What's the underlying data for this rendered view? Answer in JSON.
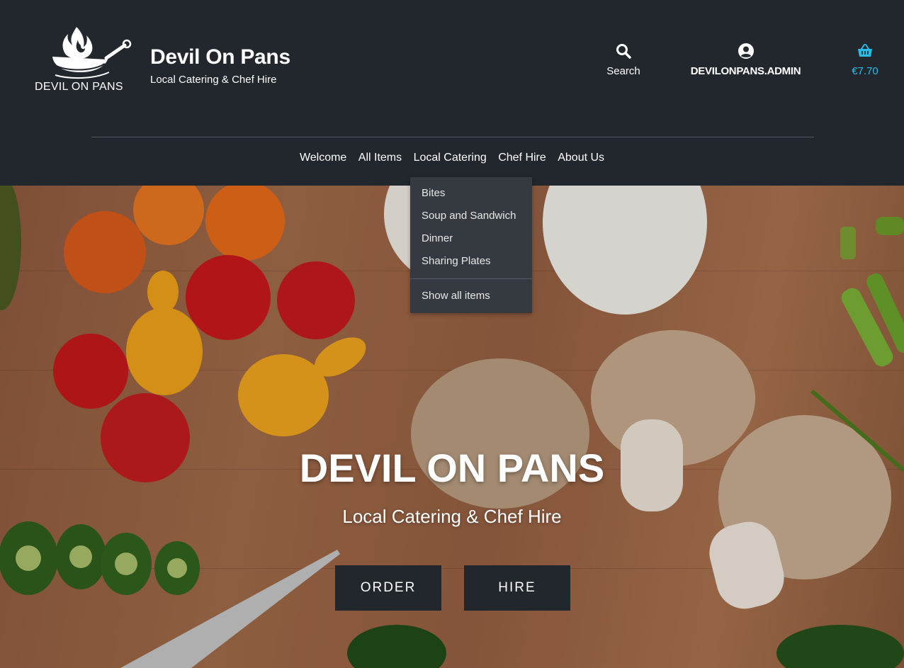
{
  "header": {
    "logo_text": "DEVIL ON PANS",
    "title": "Devil On Pans",
    "tagline": "Local Catering & Chef Hire",
    "search_label": "Search",
    "search_icon": "search-icon",
    "account_label": "DEVILONPANS.ADMIN",
    "account_icon": "user-circle-icon",
    "cart_total": "€7.70",
    "cart_icon": "shopping-basket-icon",
    "cart_color": "#2bbbe6",
    "background": "#22262d"
  },
  "nav": {
    "items": [
      {
        "label": "Welcome"
      },
      {
        "label": "All Items"
      },
      {
        "label": "Local Catering"
      },
      {
        "label": "Chef Hire"
      },
      {
        "label": "About Us"
      }
    ]
  },
  "dropdown": {
    "items": [
      {
        "label": "Bites"
      },
      {
        "label": "Soup and Sandwich"
      },
      {
        "label": "Dinner"
      },
      {
        "label": "Sharing Plates"
      }
    ],
    "show_all": "Show all items"
  },
  "hero": {
    "title": "DEVIL ON PANS",
    "subtitle": "Local Catering & Chef Hire",
    "order_button": "ORDER",
    "hire_button": "HIRE"
  }
}
